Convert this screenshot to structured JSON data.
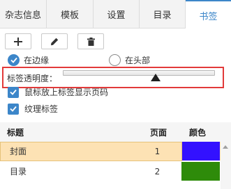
{
  "tabs": [
    {
      "label": "杂志信息",
      "active": false
    },
    {
      "label": "模板",
      "active": false
    },
    {
      "label": "设置",
      "active": false
    },
    {
      "label": "目录",
      "active": false
    },
    {
      "label": "书签",
      "active": true
    }
  ],
  "toolbar": {
    "buttons": [
      {
        "icon": "plus-icon"
      },
      {
        "icon": "pencil-icon"
      },
      {
        "icon": "trash-icon"
      }
    ]
  },
  "position": {
    "options": [
      {
        "label": "在边缘",
        "checked": true
      },
      {
        "label": "在头部",
        "checked": false
      }
    ]
  },
  "opacity": {
    "label": "标签透明度："
  },
  "options": {
    "show_page_on_hover": {
      "label": "鼠标放上标签显示页码",
      "checked": true
    },
    "textured": {
      "label": "纹理标签",
      "checked": true
    }
  },
  "table": {
    "headers": {
      "title": "标题",
      "page": "页面",
      "color": "颜色"
    },
    "rows": [
      {
        "title": "封面",
        "page": "1",
        "color": "#3311ff",
        "selected": true
      },
      {
        "title": "目录",
        "page": "2",
        "color": "#2e8b0a",
        "selected": false
      }
    ]
  },
  "colors": {
    "accent": "#3c86c9",
    "highlight": "#e23a3a",
    "selected_row": "#fde2b4"
  }
}
